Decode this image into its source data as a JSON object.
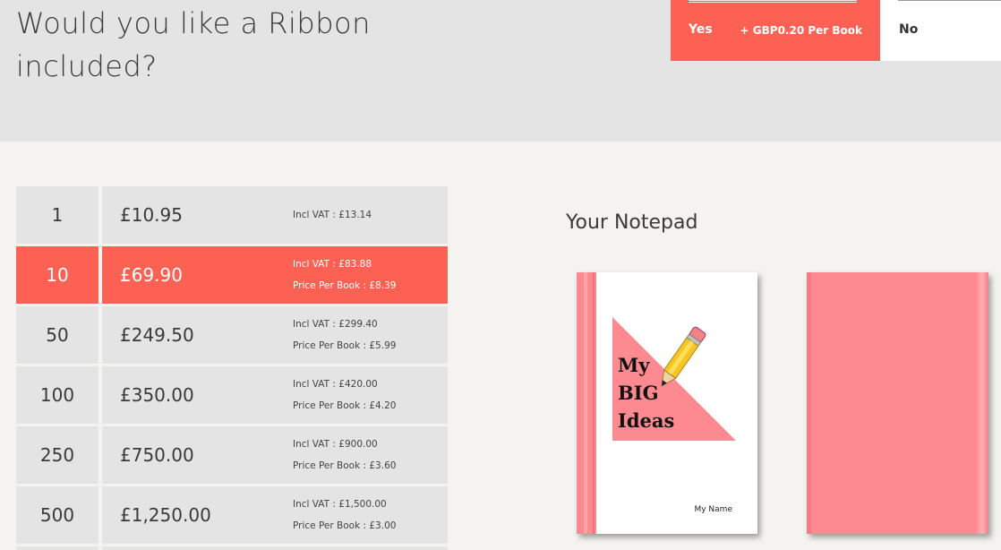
{
  "ribbon": {
    "question": "Would you like a Ribbon included?",
    "yes_label": "Yes",
    "yes_extra": "+ GBP0.20 Per Book",
    "no_label": "No"
  },
  "pricing": [
    {
      "qty": "1",
      "price": "£10.95",
      "vat": "Incl VAT : £13.14",
      "per_book": ""
    },
    {
      "qty": "10",
      "price": "£69.90",
      "vat": "Incl VAT : £83.88",
      "per_book": "Price Per Book : £8.39"
    },
    {
      "qty": "50",
      "price": "£249.50",
      "vat": "Incl VAT : £299.40",
      "per_book": "Price Per Book : £5.99"
    },
    {
      "qty": "100",
      "price": "£350.00",
      "vat": "Incl VAT : £420.00",
      "per_book": "Price Per Book : £4.20"
    },
    {
      "qty": "250",
      "price": "£750.00",
      "vat": "Incl VAT : £900.00",
      "per_book": "Price Per Book : £3.60"
    },
    {
      "qty": "500",
      "price": "£1,250.00",
      "vat": "Incl VAT : £1,500.00",
      "per_book": "Price Per Book : £3.00"
    }
  ],
  "notepad": {
    "title": "Your Notepad",
    "cover_line1": "My",
    "cover_line2": "BIG",
    "cover_line3": "Ideas",
    "cover_name": "My Name"
  },
  "colors": {
    "accent": "#fc6153",
    "cover_pink": "#fd8a90",
    "panel_grey": "#e4e4e4",
    "background": "#f4f3ef"
  }
}
